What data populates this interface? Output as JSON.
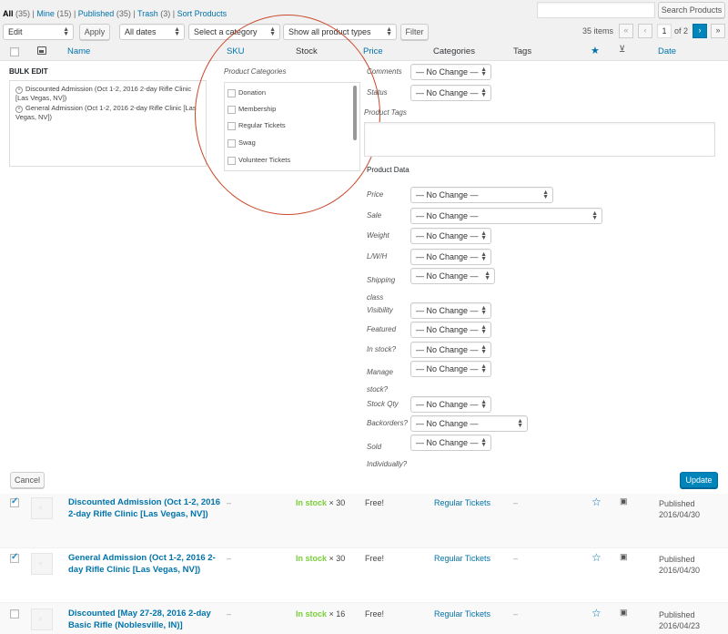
{
  "subsubsub": [
    {
      "label": "All",
      "count": "(35)",
      "current": true
    },
    {
      "label": "Mine",
      "count": "(15)"
    },
    {
      "label": "Published",
      "count": "(35)"
    },
    {
      "label": "Trash",
      "count": "(3)"
    },
    {
      "label": "Sort Products",
      "count": ""
    }
  ],
  "search": {
    "button": "Search Products",
    "value": ""
  },
  "tablenav": {
    "bulk_action": "Edit",
    "apply": "Apply",
    "dates": "All dates",
    "category": "Select a category",
    "product_types": "Show all product types",
    "filter": "Filter",
    "items": "35 items",
    "first": "«",
    "prev": "‹",
    "page": "1",
    "of": "of 2",
    "next": "›",
    "last": "»"
  },
  "columns": {
    "name": "Name",
    "sku": "SKU",
    "stock": "Stock",
    "price": "Price",
    "categories": "Categories",
    "tags": "Tags",
    "date": "Date"
  },
  "bulk_edit": {
    "title": "BULK EDIT",
    "items": [
      "Discounted Admission (Oct 1-2, 2016 2-day Rifle Clinic [Las Vegas, NV])",
      "General Admission (Oct 1-2, 2016 2-day Rifle Clinic [Las Vegas, NV])"
    ],
    "categories_label": "Product Categories",
    "categories": [
      "Donation",
      "Membership",
      "Regular Tickets",
      "Swag",
      "Volunteer Tickets"
    ],
    "fields": {
      "comments": {
        "label": "Comments",
        "value": "— No Change —"
      },
      "status": {
        "label": "Status",
        "value": "— No Change —"
      },
      "tags_label": "Product Tags",
      "product_data_label": "Product Data",
      "price": {
        "label": "Price",
        "value": "— No Change —"
      },
      "sale": {
        "label": "Sale",
        "value": "— No Change —"
      },
      "weight": {
        "label": "Weight",
        "value": "— No Change —"
      },
      "lwh": {
        "label": "L/W/H",
        "value": "— No Change —"
      },
      "shipping_class": {
        "label1": "Shipping",
        "label2": "class",
        "value": "— No Change —"
      },
      "visibility": {
        "label": "Visibility",
        "value": "— No Change —"
      },
      "featured": {
        "label": "Featured",
        "value": "— No Change —"
      },
      "in_stock": {
        "label": "In stock?",
        "value": "— No Change —"
      },
      "manage_stock": {
        "label1": "Manage",
        "label2": "stock?",
        "value": "— No Change —"
      },
      "stock_qty": {
        "label": "Stock Qty",
        "value": "— No Change —"
      },
      "backorders": {
        "label": "Backorders?",
        "value": "— No Change —"
      },
      "sold_individually": {
        "label1": "Sold",
        "label2": "Individually?",
        "value": "— No Change —"
      }
    },
    "cancel": "Cancel",
    "update": "Update"
  },
  "rows": [
    {
      "title": "Discounted Admission (Oct 1-2, 2016 2-day Rifle Clinic [Las Vegas, NV])",
      "sku": "–",
      "stock_status": "In stock",
      "stock_qty": "× 30",
      "price": "Free!",
      "category": "Regular Tickets",
      "tags": "–",
      "status": "Published",
      "date": "2016/04/30",
      "checked": true
    },
    {
      "title": "General Admission (Oct 1-2, 2016 2-day Rifle Clinic [Las Vegas, NV])",
      "sku": "–",
      "stock_status": "In stock",
      "stock_qty": "× 30",
      "price": "Free!",
      "category": "Regular Tickets",
      "tags": "–",
      "status": "Published",
      "date": "2016/04/30",
      "checked": true
    },
    {
      "title": "Discounted [May 27-28, 2016 2-day Basic Rifle (Noblesville, IN)]",
      "sku": "–",
      "stock_status": "In stock",
      "stock_qty": "× 16",
      "price": "Free!",
      "category": "Regular Tickets",
      "tags": "–",
      "status": "Published",
      "date": "2016/04/23",
      "checked": false
    }
  ],
  "colors": {
    "link": "#0073aa",
    "instock": "#7ad03a",
    "primary": "#0085ba",
    "highlight_circle": "#c9492a"
  },
  "icons": {
    "thumbnail_column": "image-icon",
    "featured_column": "star-icon",
    "type_column": "cart-icon",
    "row_featured": "star-outline-icon",
    "row_type": "ticket-icon"
  }
}
